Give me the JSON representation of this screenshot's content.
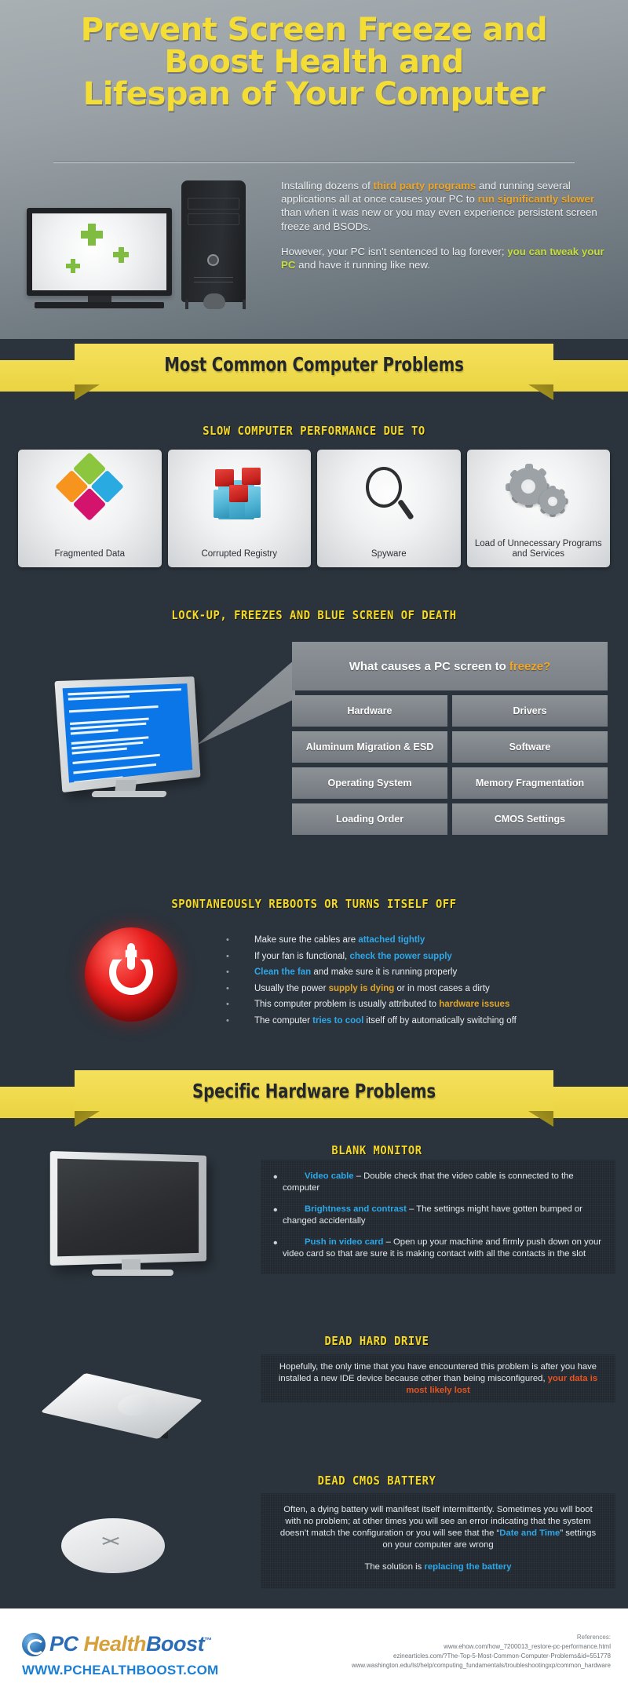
{
  "header": {
    "title_line1": "Prevent Screen Freeze and",
    "title_line2": "Boost Health and",
    "title_line3": "Lifespan of Your Computer",
    "intro_p1_a": "Installing dozens of ",
    "intro_p1_hl1": "third party programs",
    "intro_p1_b": " and running several applications all at once causes your PC to ",
    "intro_p1_hl2": "run significantly slower",
    "intro_p1_c": " than when it was new or you may even experience persistent screen freeze and BSODs.",
    "intro_p2_a": "However, your PC isn’t sentenced to lag forever; ",
    "intro_p2_hl": "you can tweak your PC",
    "intro_p2_b": " and have it running like new."
  },
  "banner1": {
    "label": "Most Common Computer Problems"
  },
  "section_slow": {
    "heading": "SLOW COMPUTER PERFORMANCE DUE TO",
    "cards": [
      {
        "icon": "puzzle-icon",
        "label": "Fragmented Data"
      },
      {
        "icon": "registry-cubes-icon",
        "label": "Corrupted Registry"
      },
      {
        "icon": "magnifier-icon",
        "label": "Spyware"
      },
      {
        "icon": "gears-icon",
        "label": "Load of Unnecessary Programs and Services"
      }
    ]
  },
  "section_freeze": {
    "heading": "LOCK-UP, FREEZES AND BLUE SCREEN OF DEATH",
    "question_a": "What causes a PC screen to",
    "question_hl": "freeze?",
    "causes": [
      "Hardware",
      "Drivers",
      "Aluminum Migration & ESD",
      "Software",
      "Operating System",
      "Memory Fragmentation",
      "Loading Order",
      "CMOS Settings"
    ]
  },
  "section_reboot": {
    "heading": "SPONTANEOUSLY REBOOTS OR TURNS ITSELF OFF",
    "bullets": [
      {
        "pre": "Make sure the cables are ",
        "hl": "attached tightly",
        "hl_color": "blue",
        "post": ""
      },
      {
        "pre": "If your fan is functional, ",
        "hl": "check the power supply",
        "hl_color": "blue",
        "post": ""
      },
      {
        "pre": "",
        "hl": "Clean the fan",
        "hl_color": "blue",
        "post": " and make sure it is running properly"
      },
      {
        "pre": "Usually the power ",
        "hl": "supply is dying",
        "hl_color": "amber",
        "post": " or in most cases a dirty"
      },
      {
        "pre": "This computer problem is usually attributed to ",
        "hl": "hardware issues",
        "hl_color": "amber",
        "post": ""
      },
      {
        "pre": "The computer ",
        "hl": "tries to cool",
        "hl_color": "blue",
        "post": " itself off by automatically switching off"
      }
    ]
  },
  "banner2": {
    "label": "Specific Hardware Problems"
  },
  "section_blank_monitor": {
    "heading": "BLANK MONITOR",
    "bullets": [
      {
        "lead": "Video cable",
        "rest": " – Double check that the video cable is connected to the computer"
      },
      {
        "lead": "Brightness and contrast",
        "rest": " – The settings might have gotten bumped or changed accidentally"
      },
      {
        "lead": "Push in video card",
        "rest": " – Open up your machine and firmly push down on your video card so that are sure it is making contact with all the contacts in the slot"
      }
    ]
  },
  "section_hard_drive": {
    "heading": "DEAD HARD DRIVE",
    "body_a": "Hopefully, the only time that you have encountered this problem is after you have installed a new IDE device because other than being misconfigured, ",
    "body_hl": "your data is most likely lost"
  },
  "section_cmos": {
    "heading": "DEAD CMOS BATTERY",
    "body_a": "Often, a dying battery will manifest itself intermittently. Sometimes you will boot with no problem; at other times you will see an error indicating that the system doesn’t match the configuration or you will see that the “",
    "body_hl": "Date and Time",
    "body_b": "” settings on your computer are wrong",
    "solution_a": "The solution is ",
    "solution_hl": "replacing the battery"
  },
  "footer": {
    "brand_pc": "PC",
    "brand_health": "Health",
    "brand_boost": "Boost",
    "brand_tm": "™",
    "url": "WWW.PCHEALTHBOOST.COM",
    "refs_label": "References:",
    "refs": [
      "www.ehow.com/how_7200013_restore-pc-performance.html",
      "ezinearticles.com/?The-Top-5-Most-Common-Computer-Problems&id=551778",
      "www.washington.edu/lst/help/computing_fundamentals/troubleshootingxp/common_hardware"
    ]
  },
  "colors": {
    "yellow": "#f5d925",
    "ribbon": "#f2dc52",
    "amber": "#f0a728",
    "blue": "#2ea8e8",
    "orange": "#e8541f",
    "lime": "#c6dd3a",
    "bg_dark": "#2b333c"
  }
}
